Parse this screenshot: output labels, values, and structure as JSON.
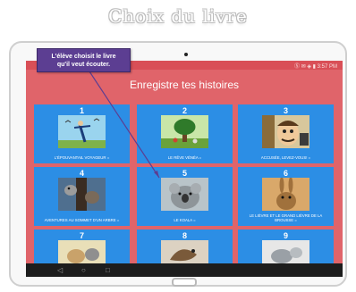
{
  "heading": "Choix du livre",
  "callout": {
    "line1": "L'élève choisit le livre",
    "line2": "qu'il veut écouter."
  },
  "app": {
    "status_right": "Ⓢ ✉ ◈ ▮ 3:57 PM",
    "title": "Enregistre tes histoires"
  },
  "books": [
    {
      "number": "1",
      "title": "L'épouvantail voyageur ="
    },
    {
      "number": "2",
      "title": "Le rêve vénéa ="
    },
    {
      "number": "3",
      "title": "Accusée, levez-vous! ="
    },
    {
      "number": "4",
      "title": "Aventures au sommet d'un arbre ="
    },
    {
      "number": "5",
      "title": "Le koala ="
    },
    {
      "number": "6",
      "title": "Le lièvre et le grand lièvre de la brousse ="
    },
    {
      "number": "7",
      "title": ""
    },
    {
      "number": "8",
      "title": ""
    },
    {
      "number": "9",
      "title": ""
    }
  ],
  "nav": {
    "back": "◁",
    "home": "○",
    "recent": "□"
  },
  "colors": {
    "screen": "#e0646a",
    "tile": "#2c8ee5",
    "callout": "#5c3e92",
    "navbar": "#1d1d1d"
  }
}
